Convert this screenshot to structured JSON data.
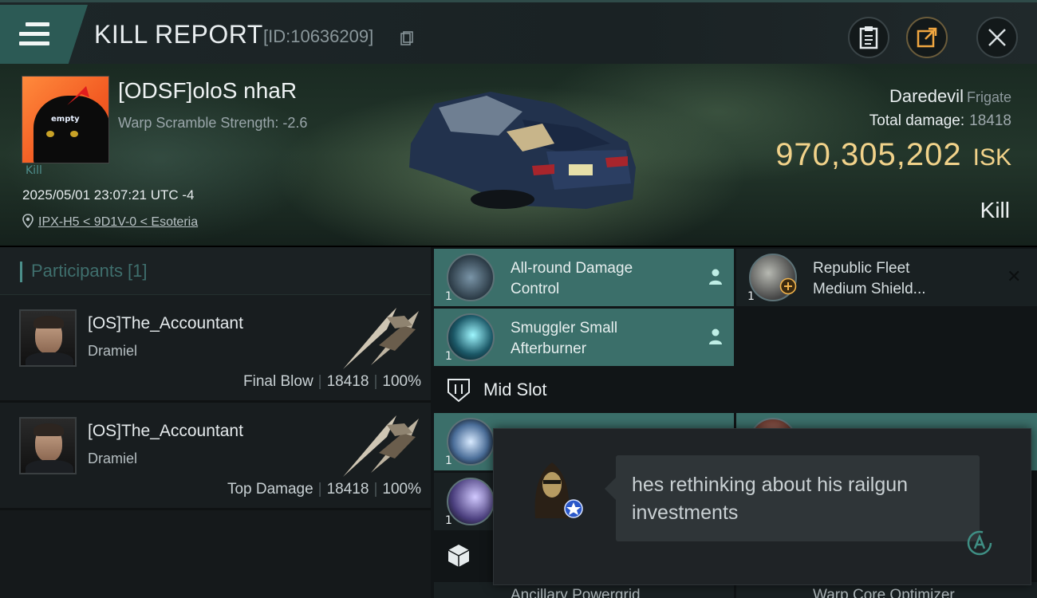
{
  "header": {
    "title": "KILL REPORT",
    "report_id": "[ID:10636209]"
  },
  "victim": {
    "avatar_text": "empty",
    "kill_tag": "Kill",
    "name": "[ODSF]oloS nhaR",
    "warp_scramble": "Warp Scramble Strength: -2.6",
    "datetime": "2025/05/01 23:07:21 UTC -4",
    "location": "IPX-H5 < 9D1V-0 < Esoteria"
  },
  "summary": {
    "ship_name": "Daredevil",
    "ship_class": "Frigate",
    "total_damage_label": "Total damage:",
    "total_damage_value": "18418",
    "isk_amount": "970,305,202",
    "isk_unit": "ISK",
    "result": "Kill"
  },
  "participants": {
    "header": "Participants [1]",
    "items": [
      {
        "name": "[OS]The_Accountant",
        "ship": "Dramiel",
        "stat_label": "Final Blow",
        "damage": "18418",
        "percent": "100%"
      },
      {
        "name": "[OS]The_Accountant",
        "ship": "Dramiel",
        "stat_label": "Top Damage",
        "damage": "18418",
        "percent": "100%"
      }
    ]
  },
  "fittings": {
    "modules_row1": [
      {
        "label": "All-round Damage\nControl",
        "qty": "1"
      },
      {
        "label": "Republic Fleet\nMedium Shield...",
        "qty": "1"
      }
    ],
    "modules_row2": [
      {
        "label": "Smuggler Small\nAfterburner",
        "qty": "1"
      }
    ],
    "mid_slot_label": "Mid Slot",
    "partial_qty_1": "1",
    "partial_qty_2": "1",
    "bottom_partial_left": "Ancillary Powergrid",
    "bottom_partial_right": "Warp Core Optimizer"
  },
  "comment": {
    "text": "hes rethinking about his railgun investments"
  },
  "colors": {
    "accent_teal": "#3b6f6a",
    "isk_gold": "#f1d28a"
  }
}
